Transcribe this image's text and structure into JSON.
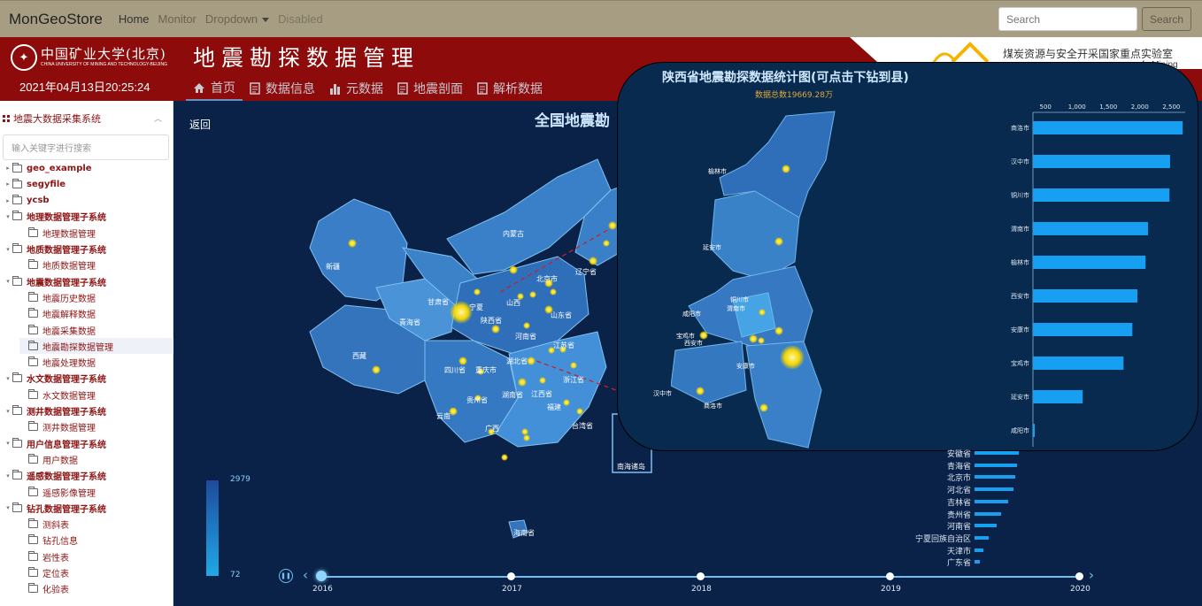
{
  "topnav": {
    "brand": "MonGeoStore",
    "links": [
      "Home",
      "Monitor",
      "Dropdown",
      "Disabled"
    ],
    "search_placeholder": "Search",
    "search_button": "Search"
  },
  "header": {
    "university": "中国矿业大学(北京)",
    "university_en": "CHINA UNIVERSITY OF MINING AND TECHNOLOGY-BEIJING",
    "datetime": "2021年04月13日20:25:24",
    "system_title": "地震勘探数据管理",
    "lab_name": "煤炭资源与安全开采国家重点实验室",
    "lab_fragment": "fe Mining"
  },
  "mainnav": {
    "items": [
      "首页",
      "数据信息",
      "元数据",
      "地震剖面",
      "解析数据"
    ]
  },
  "sidebar": {
    "title": "地震大数据采集系统",
    "collapse": "︿",
    "search_placeholder": "输入关键字进行搜索",
    "tree": [
      {
        "label": "geo_example",
        "level": 0
      },
      {
        "label": "segyfile",
        "level": 0
      },
      {
        "label": "ycsb",
        "level": 0
      },
      {
        "label": "地理数据管理子系统",
        "level": 0
      },
      {
        "label": "地理数据管理",
        "level": 1
      },
      {
        "label": "地质数据管理子系统",
        "level": 0
      },
      {
        "label": "地质数据管理",
        "level": 1
      },
      {
        "label": "地震数据管理子系统",
        "level": 0
      },
      {
        "label": "地震历史数据",
        "level": 1
      },
      {
        "label": "地震解释数据",
        "level": 1
      },
      {
        "label": "地震采集数据",
        "level": 1
      },
      {
        "label": "地震勘探数据管理",
        "level": 1
      },
      {
        "label": "地震处理数据",
        "level": 1
      },
      {
        "label": "水文数据管理子系统",
        "level": 0
      },
      {
        "label": "水文数据管理",
        "level": 1
      },
      {
        "label": "测井数据管理子系统",
        "level": 0
      },
      {
        "label": "测井数据管理",
        "level": 1
      },
      {
        "label": "用户信息管理子系统",
        "level": 0
      },
      {
        "label": "用户数据",
        "level": 1
      },
      {
        "label": "遥感数据管理子系统",
        "level": 0
      },
      {
        "label": "遥感影像管理",
        "level": 1
      },
      {
        "label": "钻孔数据管理子系统",
        "level": 0
      },
      {
        "label": "测斜表",
        "level": 1
      },
      {
        "label": "钻孔信息",
        "level": 1
      },
      {
        "label": "岩性表",
        "level": 1
      },
      {
        "label": "定位表",
        "level": 1
      },
      {
        "label": "化验表",
        "level": 1
      }
    ]
  },
  "main": {
    "back": "返回",
    "map_title": "全国地震勘",
    "province_labels": [
      "新疆",
      "西藏",
      "青海省",
      "甘肃省",
      "内蒙古",
      "宁夏",
      "陕西省",
      "山西",
      "河南省",
      "四川省",
      "重庆市",
      "湖北省",
      "湖南省",
      "贵州省",
      "云南",
      "广西",
      "江西省",
      "浙江省",
      "福建",
      "台湾省",
      "江苏省",
      "山东省",
      "辽宁省",
      "海南省",
      "南海诸岛",
      "北京市"
    ],
    "scale_max": "2979",
    "scale_min": "72",
    "bottom_list": [
      "安徽省",
      "青海省",
      "北京市",
      "河北省",
      "吉林省",
      "贵州省",
      "河南省",
      "宁夏回族自治区",
      "天津市",
      "广东省"
    ],
    "timeline": {
      "years": [
        "2016",
        "2017",
        "2018",
        "2019",
        "2020"
      ],
      "current": "2016"
    }
  },
  "overlay": {
    "title": "陕西省地震勘探数据统计图(可点击下钻到县)",
    "subtitle": "数据总数19669.28万",
    "city_labels": [
      "榆林市",
      "延安市",
      "铜川市",
      "渭南市",
      "咸阳市",
      "西安市",
      "宝鸡市",
      "汉中市",
      "安康市",
      "商洛市"
    ]
  },
  "chart_data": {
    "type": "bar",
    "orientation": "horizontal",
    "categories": [
      "商洛市",
      "汉中市",
      "铜川市",
      "渭南市",
      "榆林市",
      "西安市",
      "安康市",
      "宝鸡市",
      "延安市",
      "咸阳市"
    ],
    "values": [
      2680,
      2480,
      2470,
      2130,
      2090,
      1960,
      1880,
      1740,
      1090,
      180
    ],
    "x_ticks": [
      "500",
      "1,000",
      "1,500",
      "2,000",
      "2,500"
    ],
    "xlim": [
      300,
      2720
    ],
    "bar_color": "#17a0f2"
  }
}
